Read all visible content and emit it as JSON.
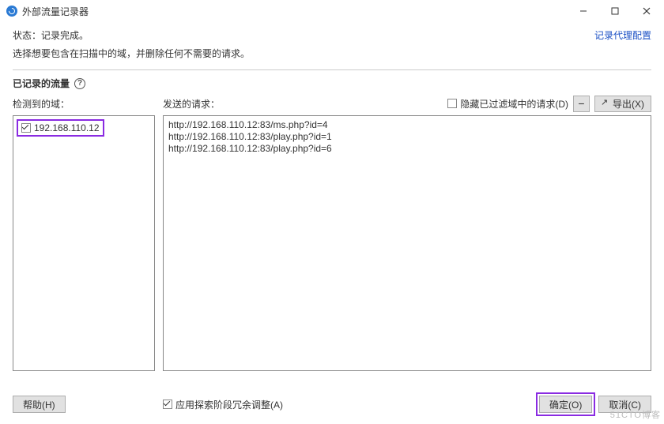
{
  "window": {
    "title": "外部流量记录器"
  },
  "info": {
    "status_prefix": "状态：",
    "status_value": "记录完成。",
    "instruction": "选择想要包含在扫描中的域，并删除任何不需要的请求。",
    "proxy_link": "记录代理配置"
  },
  "section": {
    "title": "已记录的流量",
    "help_glyph": "?"
  },
  "left": {
    "label": "检测到的域：",
    "domains": [
      {
        "checked": true,
        "host": "192.168.110.12"
      }
    ]
  },
  "right": {
    "label": "发送的请求：",
    "hide_filtered_label": "隐藏已过滤域中的请求(D)",
    "hide_filtered_checked": false,
    "remove_tooltip": "删除",
    "export_label": "导出(X)",
    "requests": [
      "http://192.168.110.12:83/ms.php?id=4",
      "http://192.168.110.12:83/play.php?id=1",
      "http://192.168.110.12:83/play.php?id=6"
    ]
  },
  "footer": {
    "help": "帮助(H)",
    "redundancy_checked": true,
    "redundancy_label": "应用探索阶段冗余调整(A)",
    "ok": "确定(O)",
    "cancel": "取消(C)"
  },
  "watermark": "51CTO博客"
}
